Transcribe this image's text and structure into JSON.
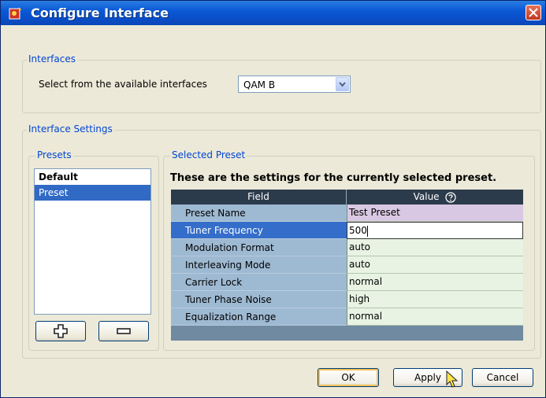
{
  "window": {
    "title": "Configure Interface"
  },
  "interfaces": {
    "legend": "Interfaces",
    "select_label": "Select from the available interfaces",
    "selected": "QAM B"
  },
  "settings": {
    "legend": "Interface Settings",
    "presets": {
      "legend": "Presets",
      "items": [
        "Default",
        "Preset"
      ],
      "selected_index": 1
    },
    "selected_preset": {
      "legend": "Selected Preset",
      "heading": "These are the settings for the currently selected preset.",
      "columns": {
        "field": "Field",
        "value": "Value"
      },
      "rows": [
        {
          "field": "Preset Name",
          "value": "Test Preset"
        },
        {
          "field": "Tuner Frequency",
          "value": "500"
        },
        {
          "field": "Modulation Format",
          "value": "auto"
        },
        {
          "field": "Interleaving Mode",
          "value": "auto"
        },
        {
          "field": "Carrier Lock",
          "value": "normal"
        },
        {
          "field": "Tuner Phase Noise",
          "value": "high"
        },
        {
          "field": "Equalization Range",
          "value": "normal"
        }
      ]
    }
  },
  "buttons": {
    "ok": "OK",
    "apply": "Apply",
    "cancel": "Cancel"
  },
  "colors": {
    "titlebar": "#0a4fc9",
    "selection": "#316ac5",
    "group_label": "#0046d5"
  }
}
